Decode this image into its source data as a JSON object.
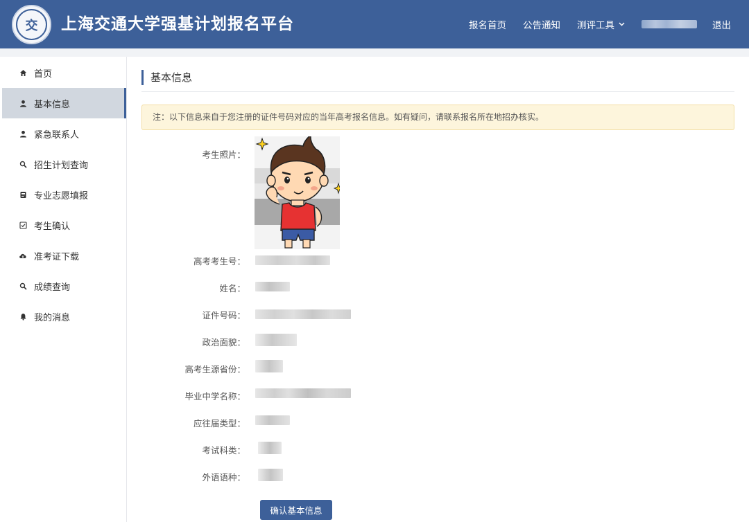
{
  "header": {
    "logo_text": "交",
    "title": "上海交通大学强基计划报名平台",
    "nav": {
      "home": "报名首页",
      "notices": "公告通知",
      "tools": "测评工具",
      "logout": "退出"
    },
    "colors": {
      "primary": "#3d6099"
    }
  },
  "sidebar": {
    "items": [
      {
        "label": "首页",
        "icon": "home-icon"
      },
      {
        "label": "基本信息",
        "icon": "user-icon",
        "active": true
      },
      {
        "label": "紧急联系人",
        "icon": "user-icon"
      },
      {
        "label": "招生计划查询",
        "icon": "search-icon"
      },
      {
        "label": "专业志愿填报",
        "icon": "form-icon"
      },
      {
        "label": "考生确认",
        "icon": "checkbox-icon"
      },
      {
        "label": "准考证下载",
        "icon": "cloud-download-icon"
      },
      {
        "label": "成绩查询",
        "icon": "search-icon"
      },
      {
        "label": "我的消息",
        "icon": "bell-icon"
      }
    ]
  },
  "main": {
    "title": "基本信息",
    "notice": "注：以下信息来自于您注册的证件号码对应的当年高考报名信息。如有疑问，请联系报名所在地招办核实。",
    "fields": [
      {
        "label": "考生照片："
      },
      {
        "label": "高考考生号："
      },
      {
        "label": "姓名："
      },
      {
        "label": "证件号码："
      },
      {
        "label": "政治面貌："
      },
      {
        "label": "高考生源省份："
      },
      {
        "label": "毕业中学名称："
      },
      {
        "label": "应往届类型："
      },
      {
        "label": "考试科类："
      },
      {
        "label": "外语语种："
      }
    ],
    "confirm_label": "确认基本信息"
  }
}
